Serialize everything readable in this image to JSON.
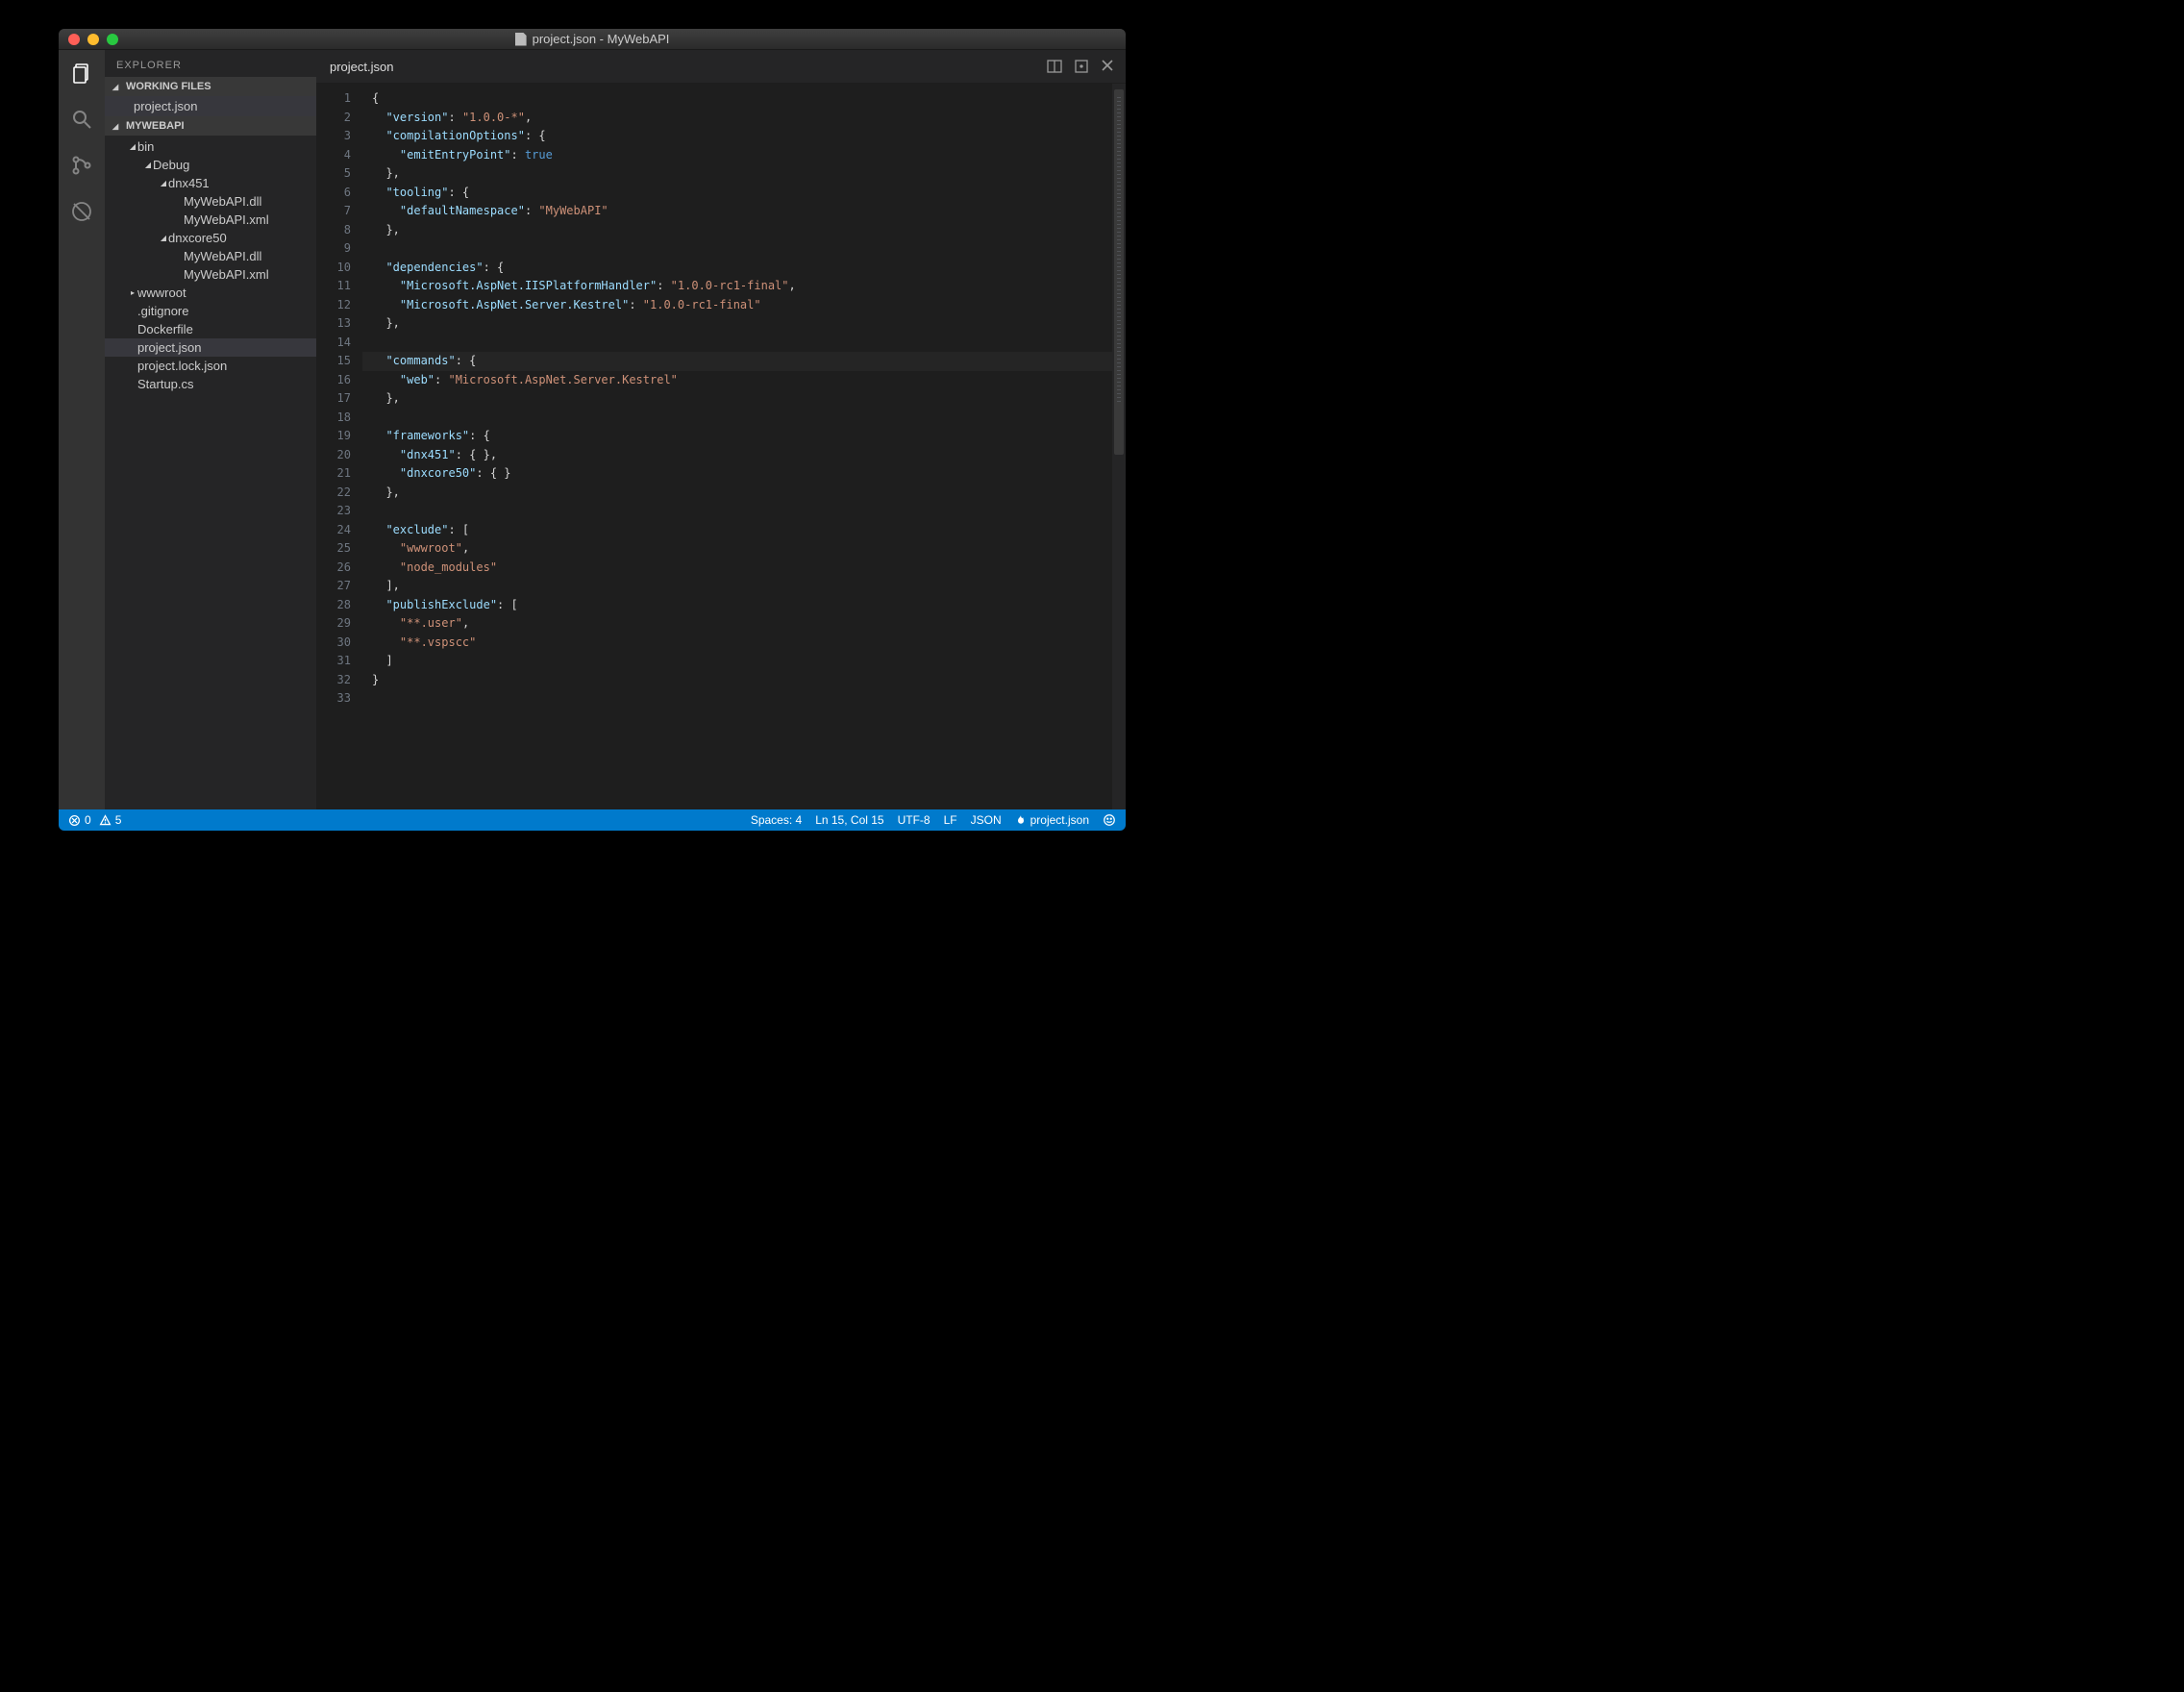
{
  "window": {
    "title": "project.json - MyWebAPI"
  },
  "activitybar": {
    "items": [
      {
        "name": "explorer",
        "active": true
      },
      {
        "name": "search",
        "active": false
      },
      {
        "name": "git",
        "active": false
      },
      {
        "name": "debug",
        "active": false
      }
    ]
  },
  "sidebar": {
    "title": "EXPLORER",
    "working_files": {
      "label": "WORKING FILES",
      "items": [
        "project.json"
      ]
    },
    "project": {
      "label": "MYWEBAPI",
      "tree": [
        {
          "depth": 1,
          "label": "bin",
          "kind": "folder",
          "expanded": true
        },
        {
          "depth": 2,
          "label": "Debug",
          "kind": "folder",
          "expanded": true
        },
        {
          "depth": 3,
          "label": "dnx451",
          "kind": "folder",
          "expanded": true
        },
        {
          "depth": 4,
          "label": "MyWebAPI.dll",
          "kind": "file"
        },
        {
          "depth": 4,
          "label": "MyWebAPI.xml",
          "kind": "file"
        },
        {
          "depth": 3,
          "label": "dnxcore50",
          "kind": "folder",
          "expanded": true
        },
        {
          "depth": 4,
          "label": "MyWebAPI.dll",
          "kind": "file"
        },
        {
          "depth": 4,
          "label": "MyWebAPI.xml",
          "kind": "file"
        },
        {
          "depth": 1,
          "label": "wwwroot",
          "kind": "folder",
          "expanded": false
        },
        {
          "depth": 1,
          "label": ".gitignore",
          "kind": "file"
        },
        {
          "depth": 1,
          "label": "Dockerfile",
          "kind": "file"
        },
        {
          "depth": 1,
          "label": "project.json",
          "kind": "file",
          "selected": true
        },
        {
          "depth": 1,
          "label": "project.lock.json",
          "kind": "file"
        },
        {
          "depth": 1,
          "label": "Startup.cs",
          "kind": "file"
        }
      ]
    }
  },
  "editor": {
    "tab_label": "project.json",
    "current_line": 15,
    "lines": [
      [
        [
          "punc",
          "{"
        ]
      ],
      [
        [
          "pad",
          "  "
        ],
        [
          "key",
          "\"version\""
        ],
        [
          "punc",
          ": "
        ],
        [
          "str",
          "\"1.0.0-*\""
        ],
        [
          "punc",
          ","
        ]
      ],
      [
        [
          "pad",
          "  "
        ],
        [
          "key",
          "\"compilationOptions\""
        ],
        [
          "punc",
          ": {"
        ]
      ],
      [
        [
          "pad",
          "    "
        ],
        [
          "key",
          "\"emitEntryPoint\""
        ],
        [
          "punc",
          ": "
        ],
        [
          "bool",
          "true"
        ]
      ],
      [
        [
          "pad",
          "  "
        ],
        [
          "punc",
          "},"
        ]
      ],
      [
        [
          "pad",
          "  "
        ],
        [
          "key",
          "\"tooling\""
        ],
        [
          "punc",
          ": {"
        ]
      ],
      [
        [
          "pad",
          "    "
        ],
        [
          "key",
          "\"defaultNamespace\""
        ],
        [
          "punc",
          ": "
        ],
        [
          "str",
          "\"MyWebAPI\""
        ]
      ],
      [
        [
          "pad",
          "  "
        ],
        [
          "punc",
          "},"
        ]
      ],
      [],
      [
        [
          "pad",
          "  "
        ],
        [
          "key",
          "\"dependencies\""
        ],
        [
          "punc",
          ": {"
        ]
      ],
      [
        [
          "pad",
          "    "
        ],
        [
          "key",
          "\"Microsoft.AspNet.IISPlatformHandler\""
        ],
        [
          "punc",
          ": "
        ],
        [
          "str",
          "\"1.0.0-rc1-final\""
        ],
        [
          "punc",
          ","
        ]
      ],
      [
        [
          "pad",
          "    "
        ],
        [
          "key",
          "\"Microsoft.AspNet.Server.Kestrel\""
        ],
        [
          "punc",
          ": "
        ],
        [
          "str",
          "\"1.0.0-rc1-final\""
        ]
      ],
      [
        [
          "pad",
          "  "
        ],
        [
          "punc",
          "},"
        ]
      ],
      [],
      [
        [
          "pad",
          "  "
        ],
        [
          "key",
          "\"commands\""
        ],
        [
          "punc",
          ": {"
        ]
      ],
      [
        [
          "pad",
          "    "
        ],
        [
          "key",
          "\"web\""
        ],
        [
          "punc",
          ": "
        ],
        [
          "str",
          "\"Microsoft.AspNet.Server.Kestrel\""
        ]
      ],
      [
        [
          "pad",
          "  "
        ],
        [
          "punc",
          "},"
        ]
      ],
      [],
      [
        [
          "pad",
          "  "
        ],
        [
          "key",
          "\"frameworks\""
        ],
        [
          "punc",
          ": {"
        ]
      ],
      [
        [
          "pad",
          "    "
        ],
        [
          "key",
          "\"dnx451\""
        ],
        [
          "punc",
          ": { },"
        ]
      ],
      [
        [
          "pad",
          "    "
        ],
        [
          "key",
          "\"dnxcore50\""
        ],
        [
          "punc",
          ": { }"
        ]
      ],
      [
        [
          "pad",
          "  "
        ],
        [
          "punc",
          "},"
        ]
      ],
      [],
      [
        [
          "pad",
          "  "
        ],
        [
          "key",
          "\"exclude\""
        ],
        [
          "punc",
          ": ["
        ]
      ],
      [
        [
          "pad",
          "    "
        ],
        [
          "str",
          "\"wwwroot\""
        ],
        [
          "punc",
          ","
        ]
      ],
      [
        [
          "pad",
          "    "
        ],
        [
          "str",
          "\"node_modules\""
        ]
      ],
      [
        [
          "pad",
          "  "
        ],
        [
          "punc",
          "],"
        ]
      ],
      [
        [
          "pad",
          "  "
        ],
        [
          "key",
          "\"publishExclude\""
        ],
        [
          "punc",
          ": ["
        ]
      ],
      [
        [
          "pad",
          "    "
        ],
        [
          "str",
          "\"**.user\""
        ],
        [
          "punc",
          ","
        ]
      ],
      [
        [
          "pad",
          "    "
        ],
        [
          "str",
          "\"**.vspscc\""
        ]
      ],
      [
        [
          "pad",
          "  "
        ],
        [
          "punc",
          "]"
        ]
      ],
      [
        [
          "punc",
          "}"
        ]
      ],
      []
    ]
  },
  "statusbar": {
    "errors": "0",
    "warnings": "5",
    "indent": "Spaces: 4",
    "position": "Ln 15, Col 15",
    "encoding": "UTF-8",
    "eol": "LF",
    "language": "JSON",
    "build_target": "project.json"
  }
}
